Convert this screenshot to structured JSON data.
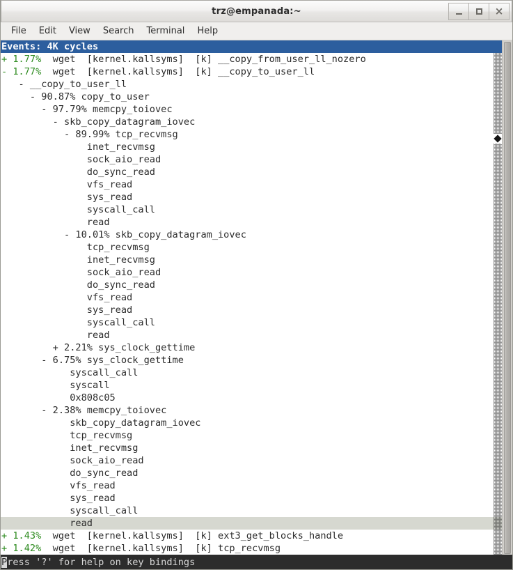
{
  "window": {
    "title": "trz@empanada:~",
    "controls": [
      {
        "name": "minimize",
        "label": "_"
      },
      {
        "name": "maximize",
        "label": "□"
      },
      {
        "name": "close",
        "label": "×"
      }
    ]
  },
  "menubar": {
    "items": [
      "File",
      "Edit",
      "View",
      "Search",
      "Terminal",
      "Help"
    ]
  },
  "terminal": {
    "header": "Events: 4K cycles",
    "statusbar": {
      "cursor_char": "P",
      "rest": "ress '?' for help on key bindings",
      "full": "Press '?' for help on key bindings"
    },
    "rows": [
      {
        "kind": "entry",
        "sign": "+",
        "pct": "1.77%",
        "comm": "wget",
        "dso": "[kernel.kallsyms]",
        "level": "[k]",
        "sym": "__copy_from_user_ll_nozero"
      },
      {
        "kind": "entry",
        "sign": "-",
        "pct": "1.77%",
        "comm": "wget",
        "dso": "[kernel.kallsyms]",
        "level": "[k]",
        "sym": "__copy_to_user_ll"
      },
      {
        "kind": "call",
        "indent": 3,
        "marker": "-",
        "pct": "",
        "sym": "__copy_to_user_ll"
      },
      {
        "kind": "call",
        "indent": 5,
        "marker": "-",
        "pct": "90.87%",
        "sym": "copy_to_user"
      },
      {
        "kind": "call",
        "indent": 7,
        "marker": "-",
        "pct": "97.79%",
        "sym": "memcpy_toiovec"
      },
      {
        "kind": "call",
        "indent": 9,
        "marker": "-",
        "pct": "",
        "sym": "skb_copy_datagram_iovec"
      },
      {
        "kind": "call",
        "indent": 11,
        "marker": "-",
        "pct": "89.99%",
        "sym": "tcp_recvmsg"
      },
      {
        "kind": "call",
        "indent": 15,
        "marker": "",
        "pct": "",
        "sym": "inet_recvmsg"
      },
      {
        "kind": "call",
        "indent": 15,
        "marker": "",
        "pct": "",
        "sym": "sock_aio_read"
      },
      {
        "kind": "call",
        "indent": 15,
        "marker": "",
        "pct": "",
        "sym": "do_sync_read"
      },
      {
        "kind": "call",
        "indent": 15,
        "marker": "",
        "pct": "",
        "sym": "vfs_read"
      },
      {
        "kind": "call",
        "indent": 15,
        "marker": "",
        "pct": "",
        "sym": "sys_read"
      },
      {
        "kind": "call",
        "indent": 15,
        "marker": "",
        "pct": "",
        "sym": "syscall_call"
      },
      {
        "kind": "call",
        "indent": 15,
        "marker": "",
        "pct": "",
        "sym": "read"
      },
      {
        "kind": "call",
        "indent": 11,
        "marker": "-",
        "pct": "10.01%",
        "sym": "skb_copy_datagram_iovec"
      },
      {
        "kind": "call",
        "indent": 15,
        "marker": "",
        "pct": "",
        "sym": "tcp_recvmsg"
      },
      {
        "kind": "call",
        "indent": 15,
        "marker": "",
        "pct": "",
        "sym": "inet_recvmsg"
      },
      {
        "kind": "call",
        "indent": 15,
        "marker": "",
        "pct": "",
        "sym": "sock_aio_read"
      },
      {
        "kind": "call",
        "indent": 15,
        "marker": "",
        "pct": "",
        "sym": "do_sync_read"
      },
      {
        "kind": "call",
        "indent": 15,
        "marker": "",
        "pct": "",
        "sym": "vfs_read"
      },
      {
        "kind": "call",
        "indent": 15,
        "marker": "",
        "pct": "",
        "sym": "sys_read"
      },
      {
        "kind": "call",
        "indent": 15,
        "marker": "",
        "pct": "",
        "sym": "syscall_call"
      },
      {
        "kind": "call",
        "indent": 15,
        "marker": "",
        "pct": "",
        "sym": "read"
      },
      {
        "kind": "call",
        "indent": 9,
        "marker": "+",
        "pct": "2.21%",
        "sym": "sys_clock_gettime"
      },
      {
        "kind": "call",
        "indent": 7,
        "marker": "-",
        "pct": "6.75%",
        "sym": "sys_clock_gettime"
      },
      {
        "kind": "call",
        "indent": 12,
        "marker": "",
        "pct": "",
        "sym": "syscall_call"
      },
      {
        "kind": "call",
        "indent": 12,
        "marker": "",
        "pct": "",
        "sym": "syscall"
      },
      {
        "kind": "call",
        "indent": 12,
        "marker": "",
        "pct": "",
        "sym": "0x808c05"
      },
      {
        "kind": "call",
        "indent": 7,
        "marker": "-",
        "pct": "2.38%",
        "sym": "memcpy_toiovec"
      },
      {
        "kind": "call",
        "indent": 12,
        "marker": "",
        "pct": "",
        "sym": "skb_copy_datagram_iovec"
      },
      {
        "kind": "call",
        "indent": 12,
        "marker": "",
        "pct": "",
        "sym": "tcp_recvmsg"
      },
      {
        "kind": "call",
        "indent": 12,
        "marker": "",
        "pct": "",
        "sym": "inet_recvmsg"
      },
      {
        "kind": "call",
        "indent": 12,
        "marker": "",
        "pct": "",
        "sym": "sock_aio_read"
      },
      {
        "kind": "call",
        "indent": 12,
        "marker": "",
        "pct": "",
        "sym": "do_sync_read"
      },
      {
        "kind": "call",
        "indent": 12,
        "marker": "",
        "pct": "",
        "sym": "vfs_read"
      },
      {
        "kind": "call",
        "indent": 12,
        "marker": "",
        "pct": "",
        "sym": "sys_read"
      },
      {
        "kind": "call",
        "indent": 12,
        "marker": "",
        "pct": "",
        "sym": "syscall_call"
      },
      {
        "kind": "call",
        "indent": 12,
        "marker": "",
        "pct": "",
        "sym": "read",
        "selected": true
      },
      {
        "kind": "entry",
        "sign": "+",
        "pct": "1.43%",
        "comm": "wget",
        "dso": "[kernel.kallsyms]",
        "level": "[k]",
        "sym": "ext3_get_blocks_handle"
      },
      {
        "kind": "entry",
        "sign": "+",
        "pct": "1.42%",
        "comm": "wget",
        "dso": "[kernel.kallsyms]",
        "level": "[k]",
        "sym": "tcp_recvmsg"
      }
    ]
  },
  "colors": {
    "header_bg": "#2c5e9e",
    "header_fg": "#ffffff",
    "pct_green": "#2e8b20",
    "selected_bg": "#d6d8d0",
    "status_bg": "#2c2c2c",
    "status_fg": "#d8d8d8",
    "terminal_bg": "#ffffff",
    "terminal_fg": "#2b2b2b"
  }
}
